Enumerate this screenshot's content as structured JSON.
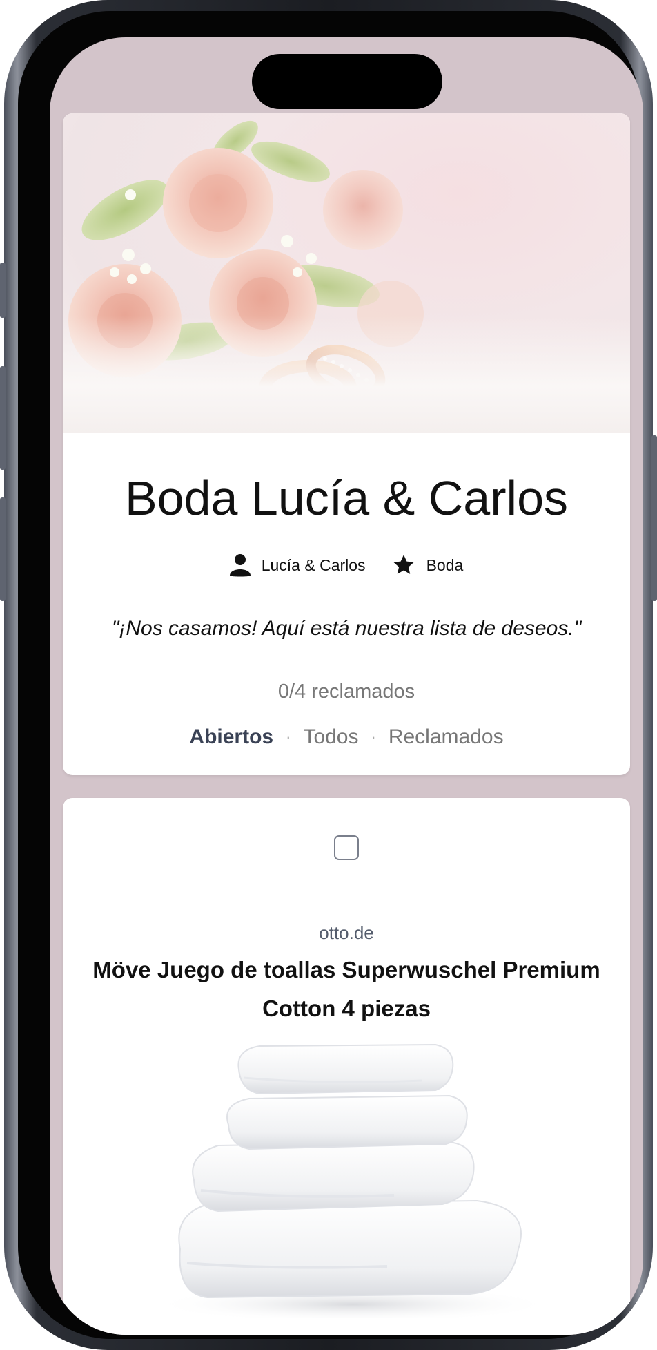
{
  "registry": {
    "title": "Boda Lucía & Carlos",
    "owner": "Lucía & Carlos",
    "occasion": "Boda",
    "quote": "\"¡Nos casamos! Aquí está nuestra lista de deseos.\"",
    "claimed_status": "0/4 reclamados",
    "filters": [
      {
        "label": "Abiertos",
        "active": true
      },
      {
        "label": "Todos",
        "active": false
      },
      {
        "label": "Reclamados",
        "active": false
      }
    ],
    "hero_image": "roses-and-wedding-rings-photo"
  },
  "items": [
    {
      "source": "otto.de",
      "name": "Möve Juego de toallas Superwuschel Premium Cotton 4 piezas",
      "image": "stack-of-white-towels-photo",
      "checked": false
    }
  ],
  "colors": {
    "background": "#d3c4ca",
    "active_filter": "#3a4255",
    "muted_text": "#777777"
  }
}
